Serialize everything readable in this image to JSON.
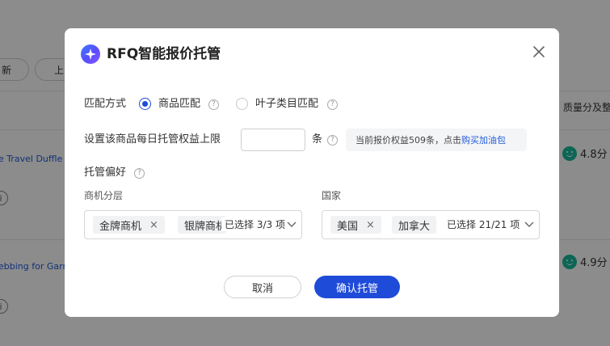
{
  "background": {
    "buttons": [
      "新",
      "上"
    ],
    "column_header": "质量分及整",
    "rows": [
      {
        "title": "e Travel Duffle I",
        "score": "4.8分"
      },
      {
        "title": "ebbing for Garr",
        "score": "4.9分"
      }
    ],
    "info_glyph": "i"
  },
  "dialog": {
    "title": "RFQ智能报价托管",
    "match": {
      "label": "匹配方式",
      "options": [
        {
          "label": "商品匹配",
          "checked": true
        },
        {
          "label": "叶子类目匹配",
          "checked": false
        }
      ]
    },
    "limit": {
      "label": "设置该商品每日托管权益上限",
      "value": "",
      "unit": "条",
      "tip_text": "当前报价权益509条，点击",
      "tip_link": "购买加油包"
    },
    "preference": {
      "label": "托管偏好",
      "tier": {
        "label": "商机分层",
        "tags": [
          "金牌商机",
          "银牌商机"
        ],
        "count": "已选择 3/3 项"
      },
      "country": {
        "label": "国家",
        "tags": [
          "美国",
          "加拿大"
        ],
        "count": "已选择 21/21 项"
      }
    },
    "buttons": {
      "cancel": "取消",
      "confirm": "确认托管"
    },
    "help_glyph": "?",
    "remove_glyph": "×"
  },
  "colors": {
    "primary": "#1f4bd9",
    "link": "#1f5bd9",
    "score_icon": "#19b89b"
  }
}
